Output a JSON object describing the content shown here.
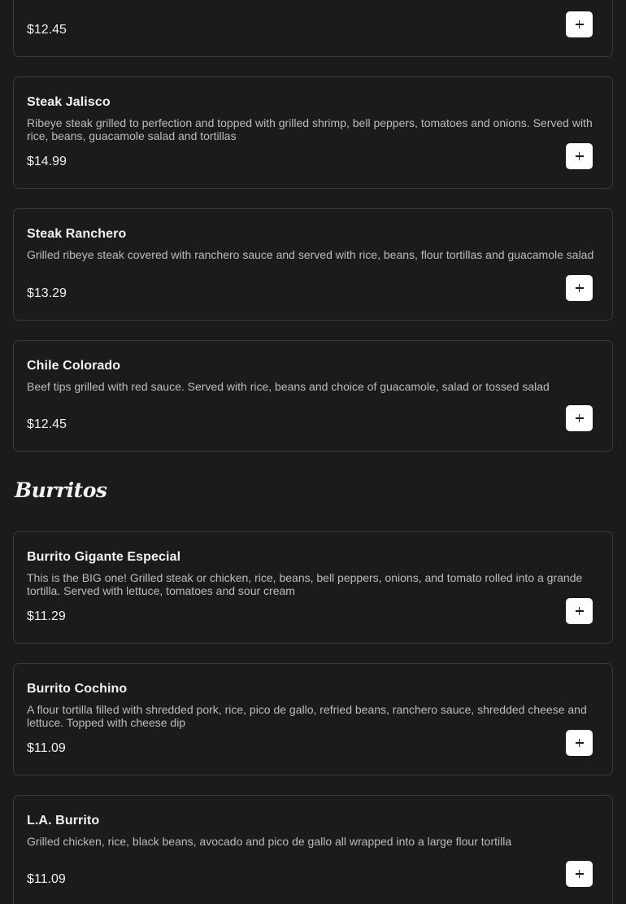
{
  "sections": [
    {
      "heading": "",
      "items": [
        {
          "name": "",
          "description": "",
          "price": "$12.45",
          "add_label": "+"
        },
        {
          "name": "Steak Jalisco",
          "description": "Ribeye steak grilled to perfection and topped with grilled shrimp, bell peppers, tomatoes and onions. Served with rice, beans, guacamole salad and tortillas",
          "price": "$14.99",
          "add_label": "+"
        },
        {
          "name": "Steak Ranchero",
          "description": "Grilled ribeye steak covered with ranchero sauce and served with rice, beans, flour tortillas and guacamole salad",
          "price": "$13.29",
          "add_label": "+"
        },
        {
          "name": "Chile Colorado",
          "description": "Beef tips grilled with red sauce. Served with rice, beans and choice of guacamole, salad or tossed salad",
          "price": "$12.45",
          "add_label": "+"
        }
      ]
    },
    {
      "heading": "Burritos",
      "items": [
        {
          "name": "Burrito Gigante Especial",
          "description": "This is the BIG one! Grilled steak or chicken, rice, beans, bell peppers, onions, and tomato rolled into a grande tortilla. Served with lettuce, tomatoes and sour cream",
          "price": "$11.29",
          "add_label": "+"
        },
        {
          "name": "Burrito Cochino",
          "description": "A flour tortilla filled with shredded pork, rice, pico de gallo, refried beans, ranchero sauce, shredded cheese and lettuce. Topped with cheese dip",
          "price": "$11.09",
          "add_label": "+"
        },
        {
          "name": "L.A. Burrito",
          "description": "Grilled chicken, rice, black beans, avocado and pico de gallo all wrapped into a large flour tortilla",
          "price": "$11.09",
          "add_label": "+"
        }
      ]
    }
  ],
  "colors": {
    "background": "#1b1b1b",
    "card_border": "#3a3a3a",
    "button_bg": "#ffffff",
    "text_primary": "#f2f2f2",
    "text_secondary": "#bcbcbc"
  },
  "icons": {
    "add": "plus-icon"
  }
}
